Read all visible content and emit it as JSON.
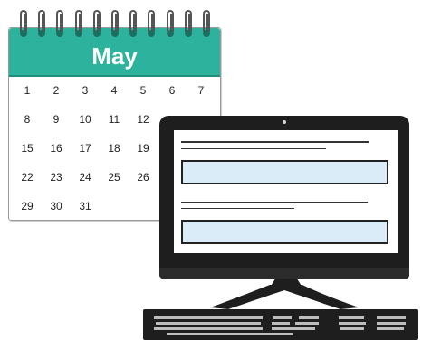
{
  "calendar": {
    "month": "May",
    "weeks": [
      [
        "1",
        "2",
        "3",
        "4",
        "5",
        "6",
        "7"
      ],
      [
        "8",
        "9",
        "10",
        "11",
        "12",
        "",
        ""
      ],
      [
        "15",
        "16",
        "17",
        "18",
        "19",
        "",
        ""
      ],
      [
        "22",
        "23",
        "24",
        "25",
        "26",
        "",
        ""
      ],
      [
        "29",
        "30",
        "31",
        "",
        "",
        "",
        ""
      ]
    ]
  },
  "colors": {
    "calendar_header": "#2db39d",
    "monitor_body": "#1e1e1e",
    "input_fill": "#d9ecf8"
  },
  "icons": [
    "calendar-icon",
    "desktop-computer-icon",
    "keyboard-icon"
  ]
}
